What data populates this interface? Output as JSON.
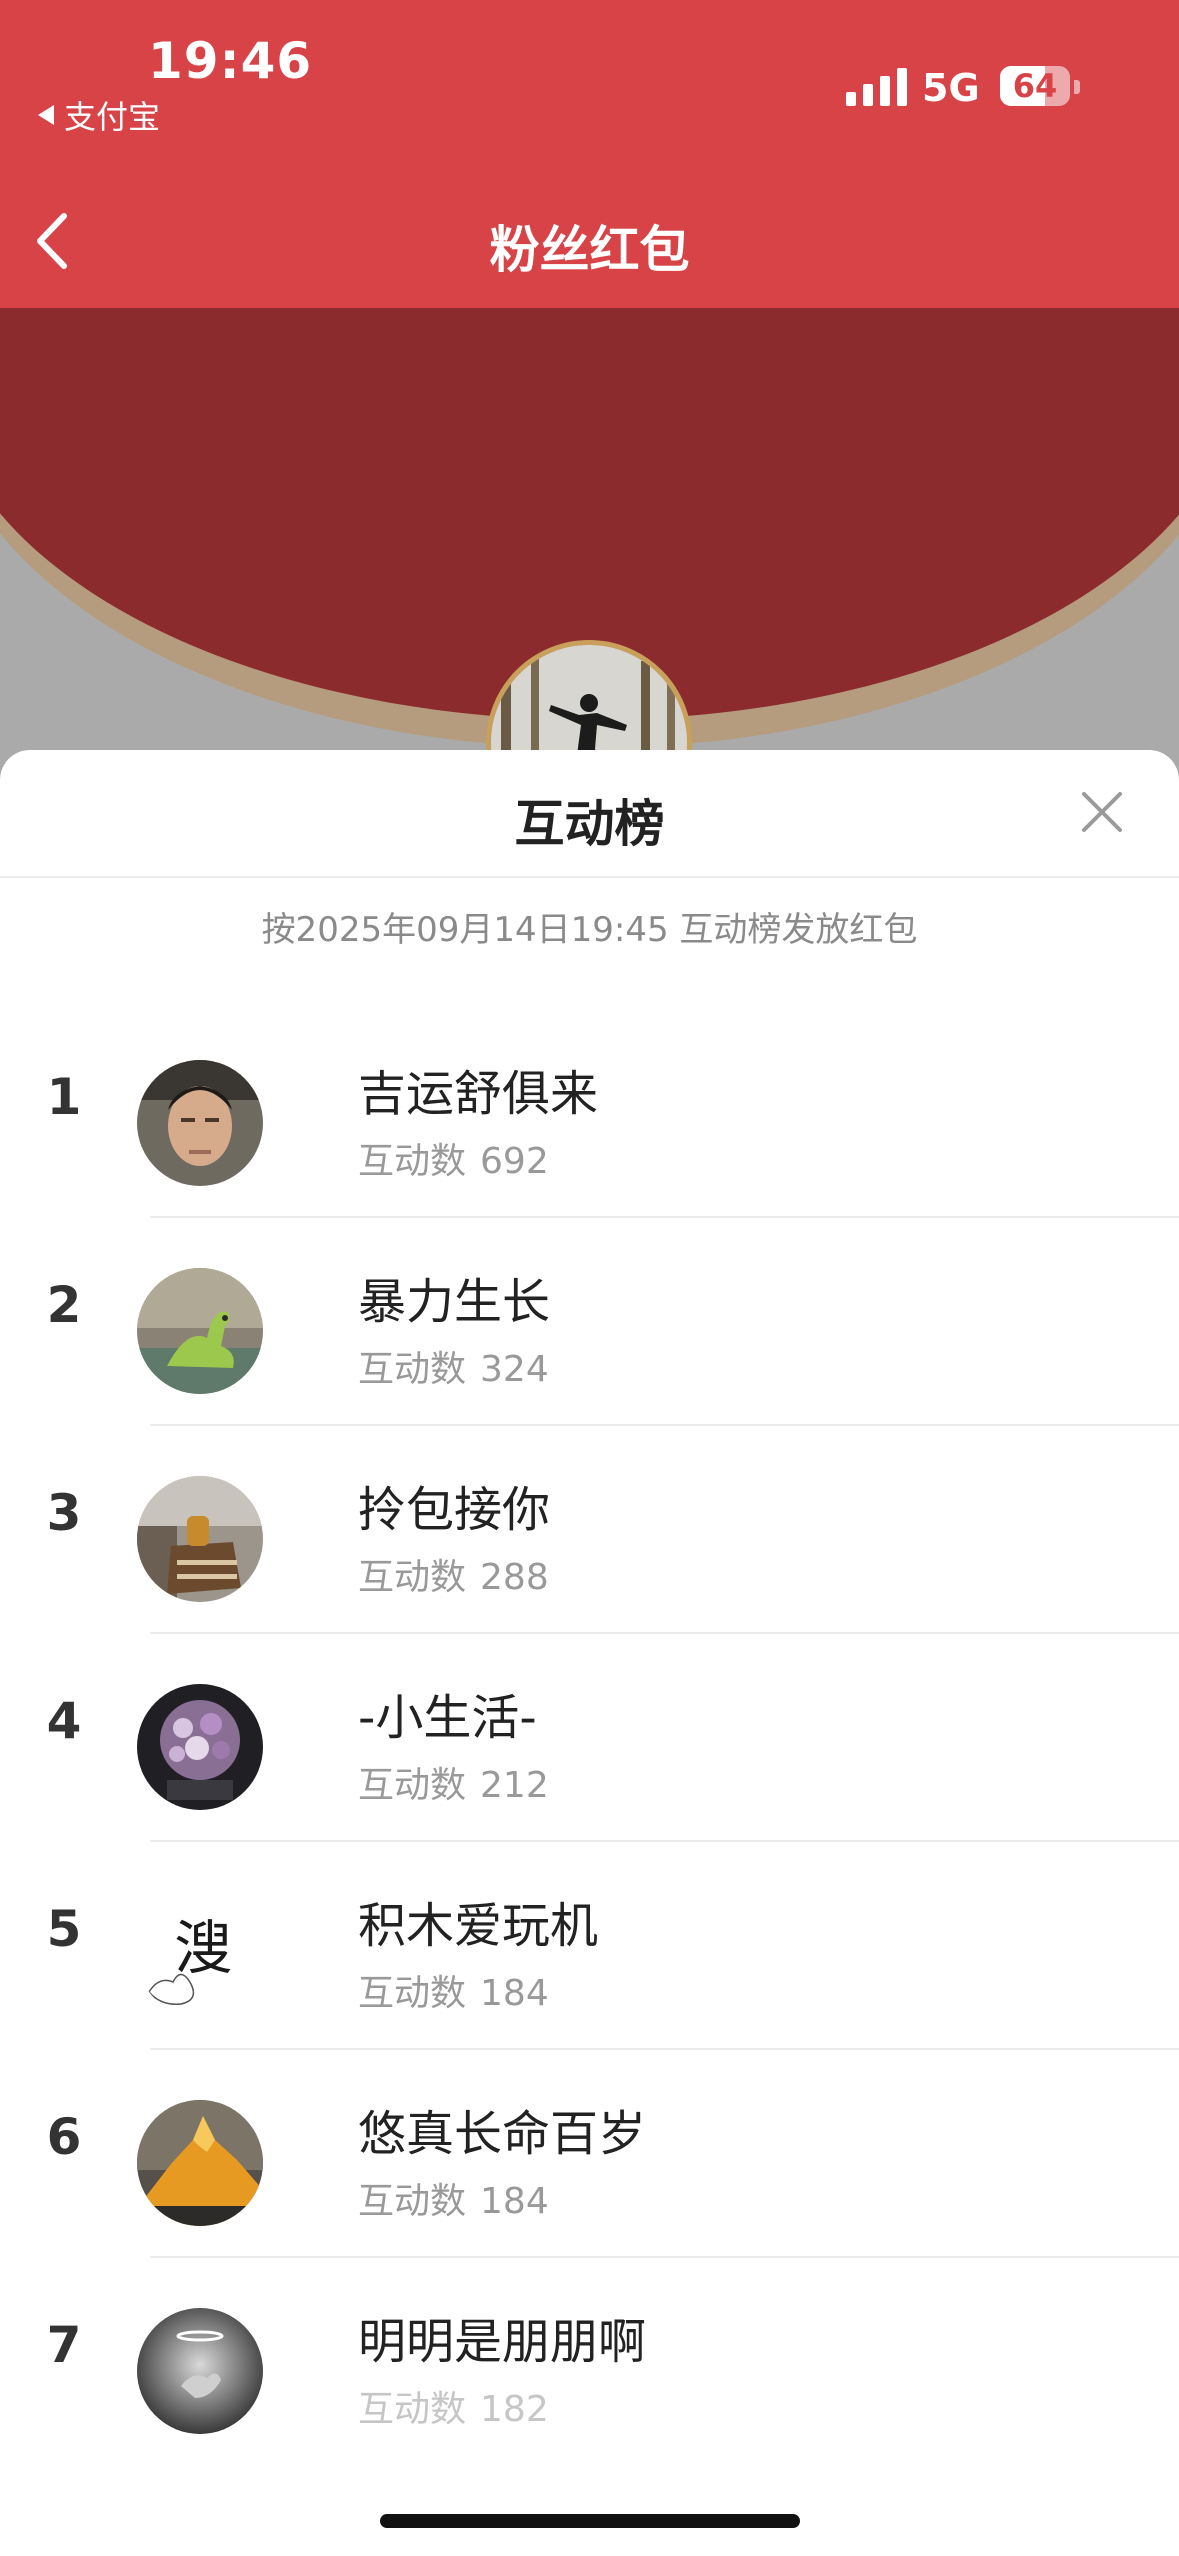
{
  "status_bar": {
    "time": "19:46",
    "back_app": "支付宝",
    "network": "5G",
    "battery": "64",
    "battery_level": 0.64
  },
  "nav": {
    "title": "粉丝红包"
  },
  "sheet": {
    "title": "互动榜",
    "notice": "按2025年09月14日19:45 互动榜发放红包",
    "count_label": "互动数",
    "rows": [
      {
        "rank": "1",
        "name": "吉运舒俱来",
        "count": "692"
      },
      {
        "rank": "2",
        "name": "暴力生长",
        "count": "324"
      },
      {
        "rank": "3",
        "name": "拎包接你",
        "count": "288"
      },
      {
        "rank": "4",
        "name": "-小生活-",
        "count": "212"
      },
      {
        "rank": "5",
        "name": "积木爱玩机",
        "count": "184",
        "avatar_text": "溲"
      },
      {
        "rank": "6",
        "name": "悠真长命百岁",
        "count": "184"
      },
      {
        "rank": "7",
        "name": "明明是朋朋啊",
        "count": "182"
      }
    ]
  },
  "colors": {
    "header_red": "#d84347",
    "backdrop_dark_red": "#8b2b2e",
    "gold": "#c9a05a"
  }
}
